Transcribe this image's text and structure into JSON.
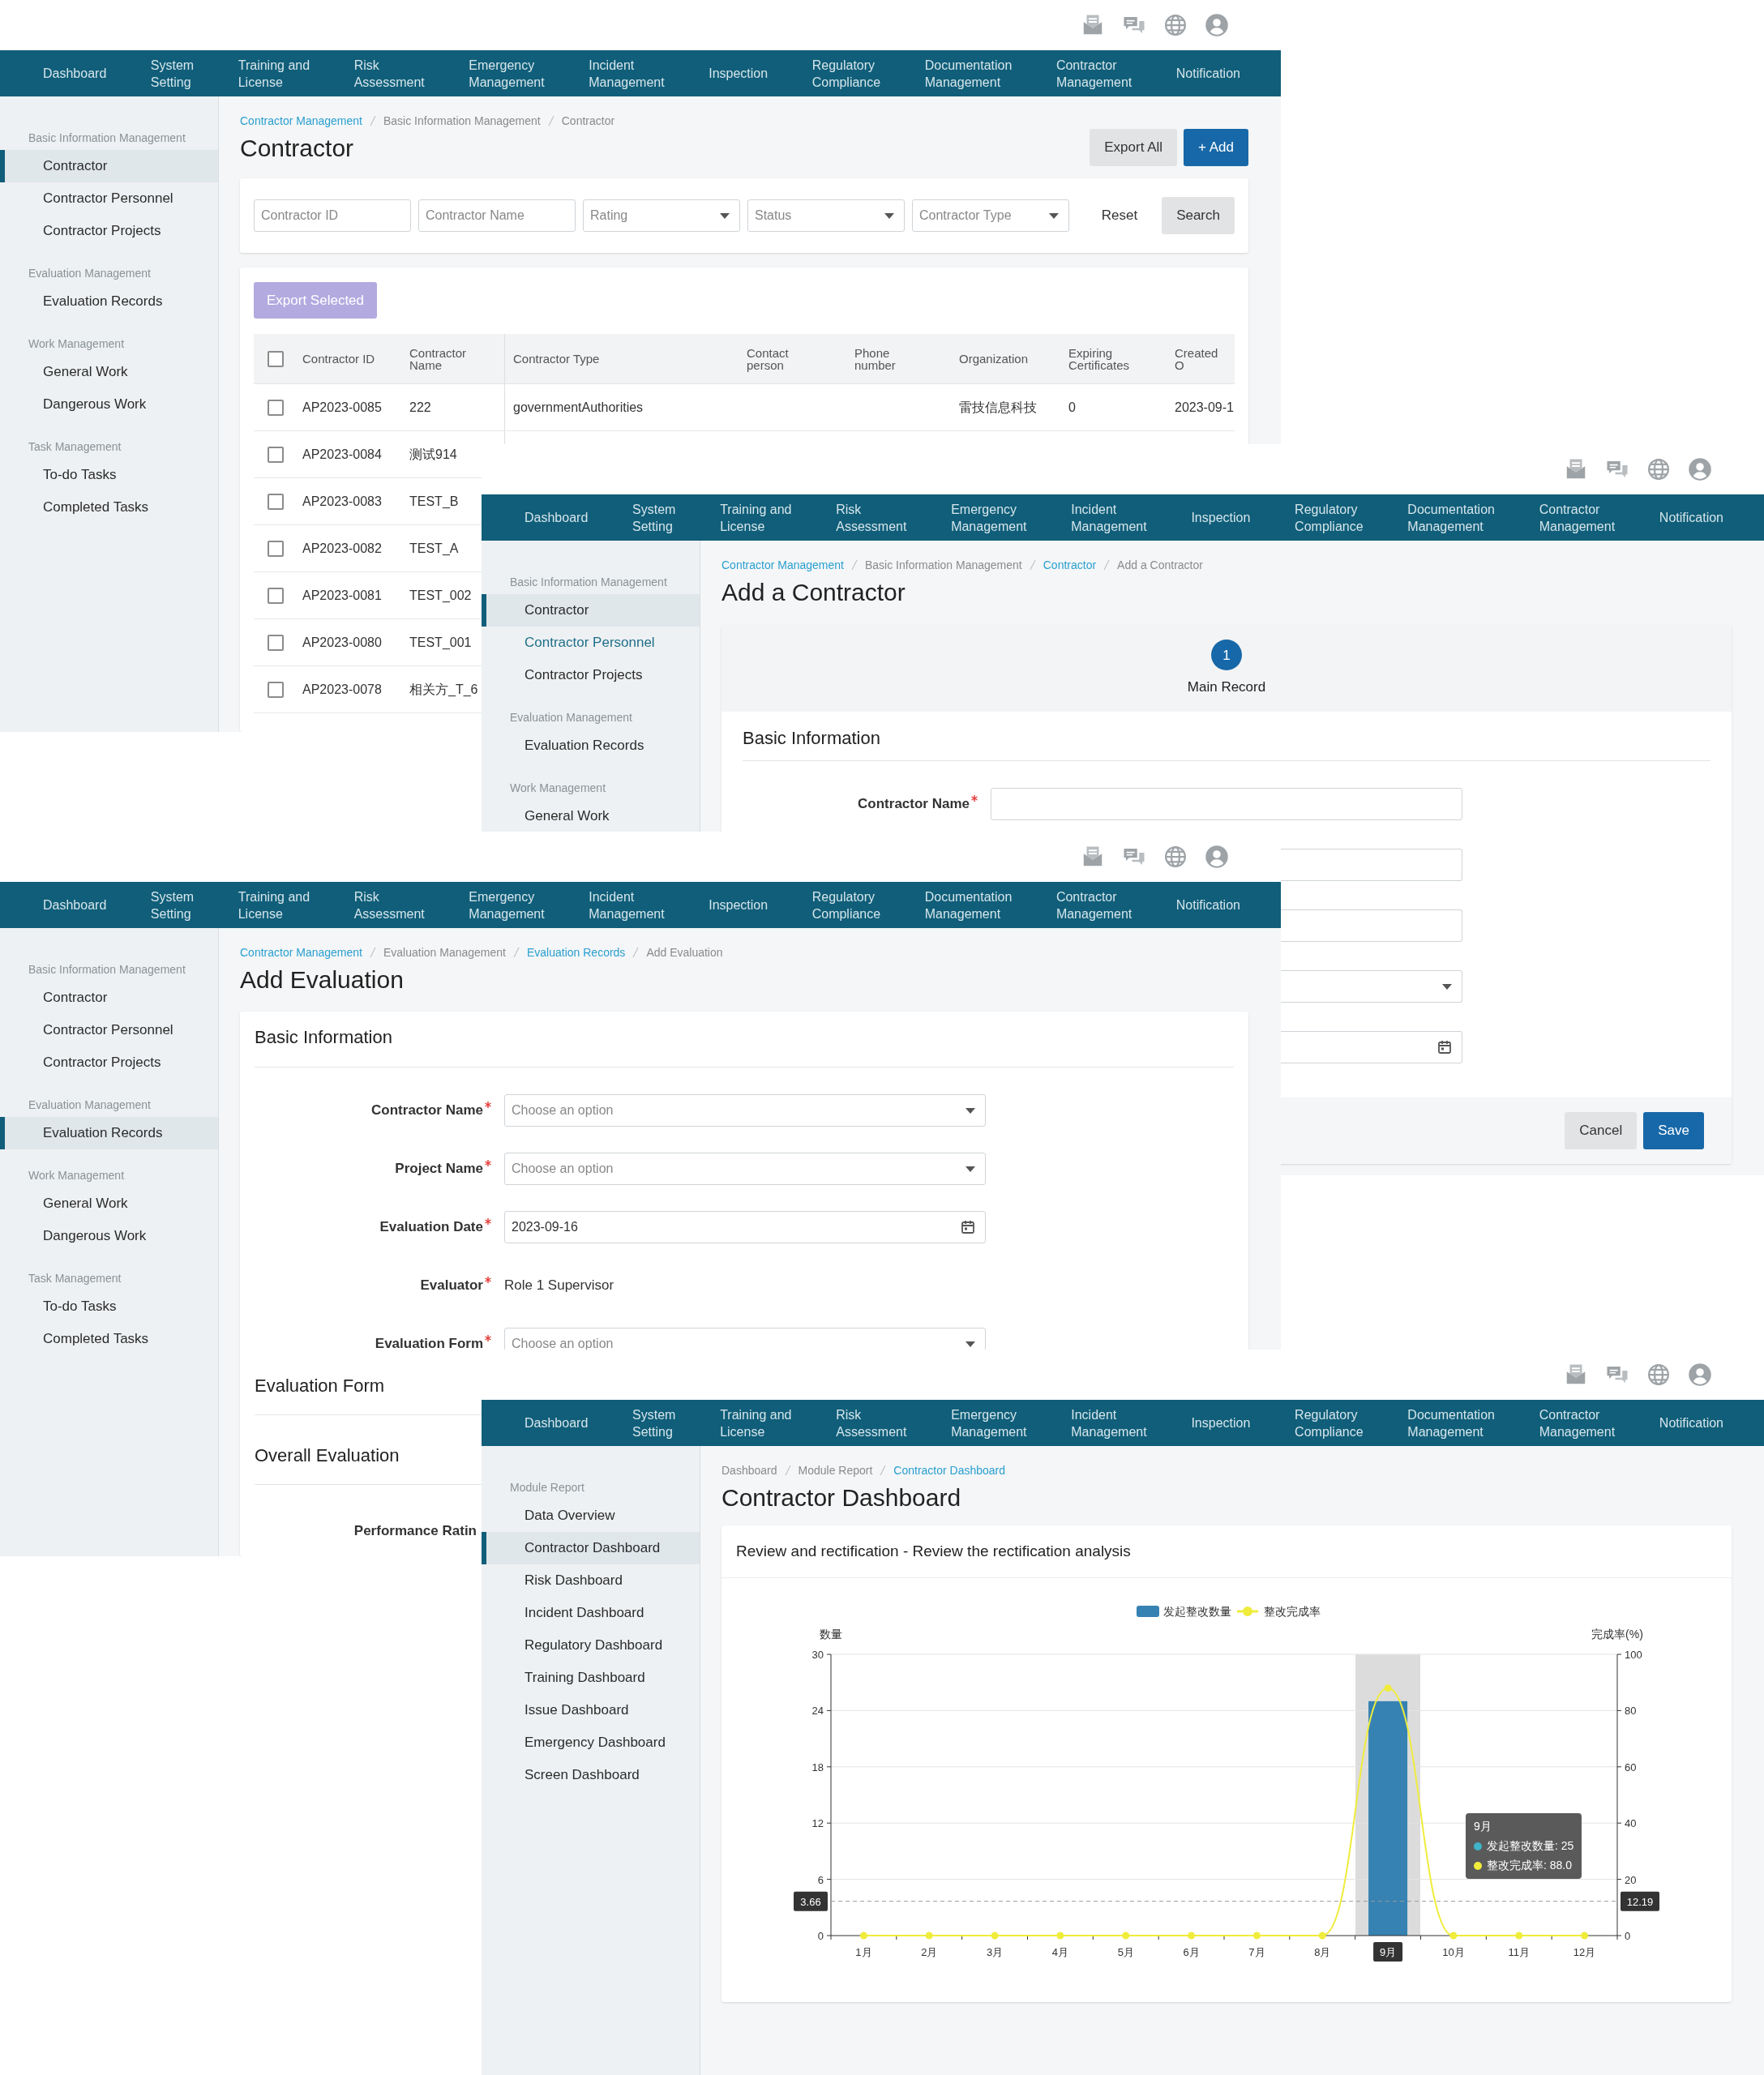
{
  "windows": [
    {
      "kind": "list_page",
      "nav": [
        "Dashboard",
        "System Setting",
        "Training and License",
        "Risk Assessment",
        "Emergency Management",
        "Incident Management",
        "Inspection",
        "Regulatory Compliance",
        "Documentation Management",
        "Contractor Management",
        "Notification"
      ],
      "sidebar": [
        {
          "heading": "Basic Information Management",
          "items": [
            {
              "label": "Contractor",
              "selected": true
            },
            {
              "label": "Contractor Personnel",
              "selected": false
            },
            {
              "label": "Contractor Projects",
              "selected": false
            }
          ]
        },
        {
          "heading": "Evaluation Management",
          "items": [
            {
              "label": "Evaluation Records",
              "selected": false
            }
          ]
        },
        {
          "heading": "Work Management",
          "items": [
            {
              "label": "General Work",
              "selected": false
            },
            {
              "label": "Dangerous Work",
              "selected": false
            }
          ]
        },
        {
          "heading": "Task Management",
          "items": [
            {
              "label": "To-do Tasks",
              "selected": false
            },
            {
              "label": "Completed Tasks",
              "selected": false
            }
          ]
        }
      ],
      "breadcrumb": [
        {
          "label": "Contractor Management",
          "link": true
        },
        {
          "label": "Basic Information Management",
          "link": false
        },
        {
          "label": "Contractor",
          "link": false
        }
      ],
      "title": "Contractor",
      "actions": [
        {
          "label": "Export All",
          "kind": "secondary"
        },
        {
          "label": "+ Add",
          "kind": "primary"
        }
      ],
      "filters": [
        {
          "placeholder": "Contractor ID",
          "kind": "text"
        },
        {
          "placeholder": "Contractor Name",
          "kind": "text"
        },
        {
          "placeholder": "Rating",
          "kind": "select"
        },
        {
          "placeholder": "Status",
          "kind": "select"
        },
        {
          "placeholder": "Contractor Type",
          "kind": "select"
        }
      ],
      "filter_buttons": [
        {
          "label": "Reset",
          "kind": "plain"
        },
        {
          "label": "Search",
          "kind": "secondary"
        }
      ],
      "bulk_action": {
        "label": "Export Selected",
        "disabled": true
      },
      "table": {
        "header_checked": false,
        "columns": [
          "Contractor ID",
          "Contractor Name",
          "Contractor Type",
          "Contact person",
          "Phone number",
          "Organization",
          "Expiring Certificates",
          "Created O"
        ],
        "rows": [
          {
            "checked": false,
            "contractor_id": "AP2023-0085",
            "contractor_name": "222",
            "contractor_type": "governmentAuthorities",
            "organization": "雷技信息科技",
            "expiring_certificates": "0",
            "column_8": "2023-09-1"
          },
          {
            "checked": false,
            "contractor_id": "AP2023-0084",
            "contractor_name": "测试914"
          },
          {
            "checked": false,
            "contractor_id": "AP2023-0083",
            "contractor_name": "TEST_B"
          },
          {
            "checked": false,
            "contractor_id": "AP2023-0082",
            "contractor_name": "TEST_A"
          },
          {
            "checked": false,
            "contractor_id": "AP2023-0081",
            "contractor_name": "TEST_002"
          },
          {
            "checked": false,
            "contractor_id": "AP2023-0080",
            "contractor_name": "TEST_001"
          },
          {
            "checked": false,
            "contractor_id": "AP2023-0078",
            "contractor_name": "相关方_T_6"
          }
        ]
      }
    },
    {
      "kind": "add_contractor",
      "nav": [
        "Dashboard",
        "System Setting",
        "Training and License",
        "Risk Assessment",
        "Emergency Management",
        "Incident Management",
        "Inspection",
        "Regulatory Compliance",
        "Documentation Management",
        "Contractor Management",
        "Notification"
      ],
      "sidebar": [
        {
          "heading": "Basic Information Management",
          "items": [
            {
              "label": "Contractor",
              "selected": true,
              "hovered": false
            },
            {
              "label": "Contractor Personnel",
              "selected": false,
              "hovered": true
            },
            {
              "label": "Contractor Projects",
              "selected": false,
              "hovered": false
            }
          ]
        },
        {
          "heading": "Evaluation Management",
          "items": [
            {
              "label": "Evaluation Records",
              "selected": false,
              "hovered": false
            }
          ]
        },
        {
          "heading": "Work Management",
          "items": [
            {
              "label": "General Work",
              "selected": false,
              "hovered": false
            }
          ]
        }
      ],
      "breadcrumb": [
        {
          "label": "Contractor Management",
          "link": true
        },
        {
          "label": "Basic Information Management",
          "link": false
        },
        {
          "label": "Contractor",
          "link": true
        },
        {
          "label": "Add a Contractor",
          "link": false
        }
      ],
      "title": "Add a Contractor",
      "steps": [
        {
          "number": "1",
          "label": "Main Record"
        }
      ],
      "section_title": "Basic Information",
      "fields": [
        {
          "label": "Contractor Name",
          "required": true,
          "kind": "text"
        },
        {
          "kind": "text"
        },
        {
          "kind": "text"
        },
        {
          "kind": "select"
        },
        {
          "kind": "date"
        }
      ],
      "buttons": [
        {
          "label": "Cancel",
          "kind": "secondary"
        },
        {
          "label": "Save",
          "kind": "primary"
        }
      ]
    },
    {
      "kind": "add_evaluation",
      "nav": [
        "Dashboard",
        "System Setting",
        "Training and License",
        "Risk Assessment",
        "Emergency Management",
        "Incident Management",
        "Inspection",
        "Regulatory Compliance",
        "Documentation Management",
        "Contractor Management",
        "Notification"
      ],
      "sidebar": [
        {
          "heading": "Basic Information Management",
          "items": [
            {
              "label": "Contractor",
              "selected": false
            },
            {
              "label": "Contractor Personnel",
              "selected": false
            },
            {
              "label": "Contractor Projects",
              "selected": false
            }
          ]
        },
        {
          "heading": "Evaluation Management",
          "items": [
            {
              "label": "Evaluation Records",
              "selected": true
            }
          ]
        },
        {
          "heading": "Work Management",
          "items": [
            {
              "label": "General Work",
              "selected": false
            },
            {
              "label": "Dangerous Work",
              "selected": false
            }
          ]
        },
        {
          "heading": "Task Management",
          "items": [
            {
              "label": "To-do Tasks",
              "selected": false
            },
            {
              "label": "Completed Tasks",
              "selected": false
            }
          ]
        }
      ],
      "breadcrumb": [
        {
          "label": "Contractor Management",
          "link": true
        },
        {
          "label": "Evaluation Management",
          "link": false
        },
        {
          "label": "Evaluation Records",
          "link": true
        },
        {
          "label": "Add Evaluation",
          "link": false
        }
      ],
      "title": "Add Evaluation",
      "section_title": "Basic Information",
      "fields": [
        {
          "label": "Contractor Name",
          "required": true,
          "kind": "select",
          "placeholder": "Choose an option"
        },
        {
          "label": "Project Name",
          "required": true,
          "kind": "select",
          "placeholder": "Choose an option"
        },
        {
          "label": "Evaluation Date",
          "required": true,
          "kind": "date",
          "value": "2023-09-16"
        },
        {
          "label": "Evaluator",
          "required": true,
          "kind": "static",
          "value": "Role 1 Supervisor"
        },
        {
          "label": "Evaluation Form",
          "required": true,
          "kind": "select",
          "placeholder": "Choose an option"
        }
      ],
      "more_sections": [
        {
          "title": "Evaluation Form"
        },
        {
          "title": "Overall Evaluation",
          "field_labels": [
            "Performance Ratin"
          ]
        }
      ]
    },
    {
      "kind": "dashboard",
      "nav": [
        "Dashboard",
        "System Setting",
        "Training and License",
        "Risk Assessment",
        "Emergency Management",
        "Incident Management",
        "Inspection",
        "Regulatory Compliance",
        "Documentation Management",
        "Contractor Management",
        "Notification"
      ],
      "sidebar": [
        {
          "heading": "Module Report",
          "items": [
            {
              "label": "Data Overview",
              "selected": false
            },
            {
              "label": "Contractor Dashboard",
              "selected": true
            },
            {
              "label": "Risk Dashboard",
              "selected": false
            },
            {
              "label": "Incident Dashboard",
              "selected": false
            },
            {
              "label": "Regulatory Dashboard",
              "selected": false
            },
            {
              "label": "Training Dashboard",
              "selected": false
            },
            {
              "label": "Issue Dashboard",
              "selected": false
            },
            {
              "label": "Emergency Dashboard",
              "selected": false
            },
            {
              "label": "Screen Dashboard",
              "selected": false
            }
          ]
        }
      ],
      "breadcrumb": [
        {
          "label": "Dashboard",
          "link": false
        },
        {
          "label": "Module Report",
          "link": false
        },
        {
          "label": "Contractor Dashboard",
          "link": true
        }
      ],
      "title": "Contractor Dashboard",
      "card_title": "Review and rectification - Review the rectification analysis",
      "chart_data": {
        "type": "bar",
        "categories": [
          "1月",
          "2月",
          "3月",
          "4月",
          "5月",
          "6月",
          "7月",
          "8月",
          "9月",
          "10月",
          "11月",
          "12月"
        ],
        "series": [
          {
            "name": "发起整改数量",
            "color": "#3682b2",
            "values": [
              0,
              0,
              0,
              0,
              0,
              0,
              0,
              0,
              25,
              0,
              0,
              0
            ]
          },
          {
            "name": "整改完成率",
            "color": "#f0ec3c",
            "type": "line",
            "axis": "y2",
            "marker": "circle",
            "values": [
              0,
              0,
              0,
              0,
              0,
              0,
              0,
              0,
              88.0,
              0,
              0,
              0
            ]
          }
        ],
        "grid": true,
        "legend": true,
        "ylabel": "数量",
        "ylim": [
          0,
          30
        ],
        "yticks": [
          0,
          6,
          12,
          18,
          24,
          30
        ],
        "y2label": "完成率(%)",
        "y2lim": [
          0,
          100
        ],
        "y2ticks": [
          0,
          20,
          40,
          60,
          80,
          100
        ],
        "ref_lines": [
          {
            "value": 3.66,
            "axis": "y",
            "label": "3.66"
          }
        ],
        "annotations": [
          "12.19"
        ]
      },
      "tooltip": {
        "title": "9月",
        "lines": [
          {
            "text": "发起整改数量: 25",
            "color": "#3fb4c9"
          },
          {
            "text": "整改完成率: 88.0",
            "color": "#f0ec3c"
          }
        ]
      }
    }
  ]
}
